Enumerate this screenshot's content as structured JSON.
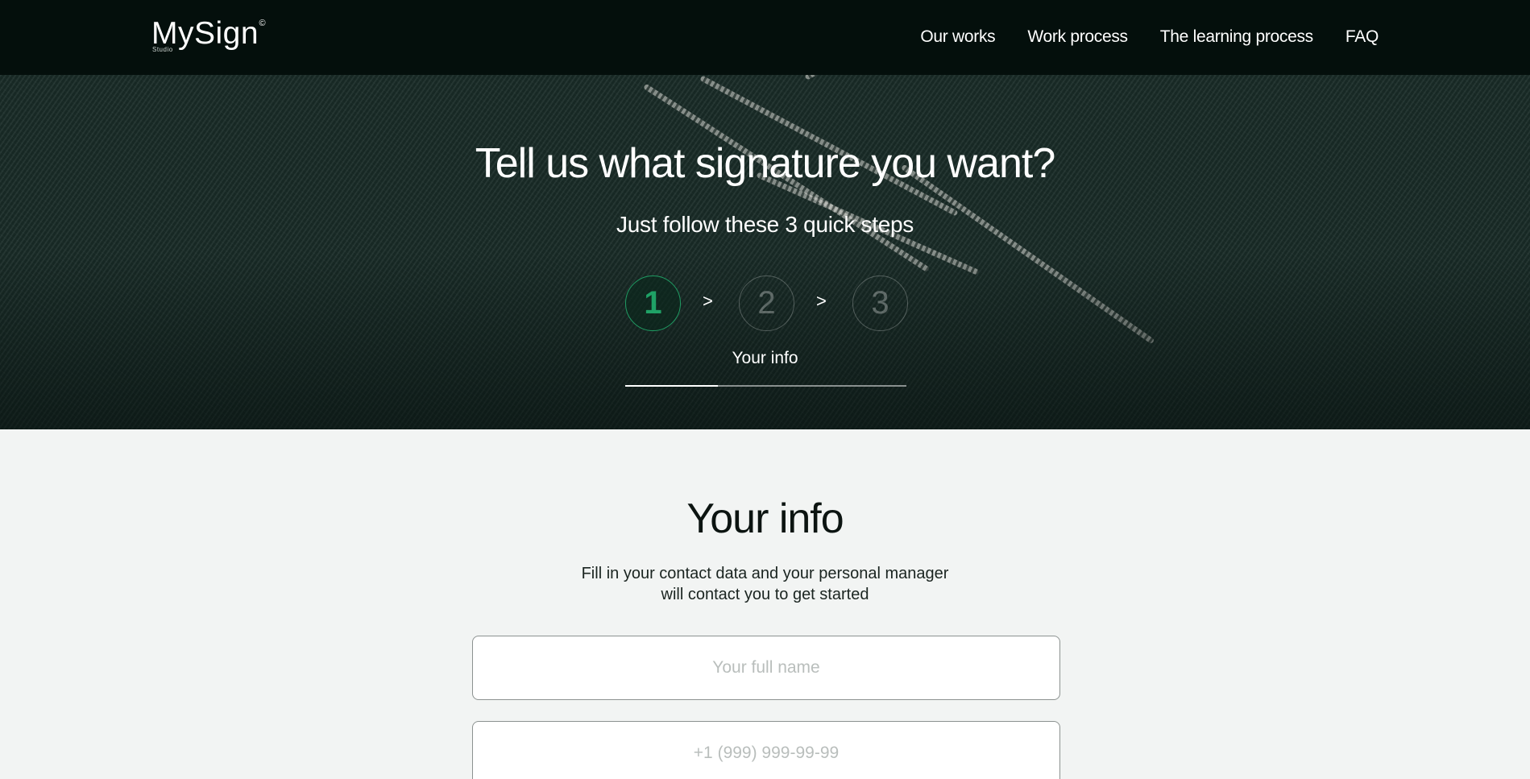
{
  "header": {
    "logo_text": "MySign",
    "logo_mark": "©",
    "logo_sub": "Studio",
    "nav": [
      {
        "label": "Our works"
      },
      {
        "label": "Work process"
      },
      {
        "label": "The learning process"
      },
      {
        "label": "FAQ"
      }
    ]
  },
  "hero": {
    "title": "Tell us what signature you want?",
    "subtitle": "Just follow these 3 quick steps",
    "steps": [
      {
        "number": "1",
        "active": true
      },
      {
        "number": "2",
        "active": false
      },
      {
        "number": "3",
        "active": false
      }
    ],
    "separator": ">",
    "current_step_label": "Your info",
    "progress": 0.33
  },
  "form": {
    "title": "Your info",
    "description_line1": "Fill in your contact data and your personal manager",
    "description_line2": "will contact you to get started",
    "name_placeholder": "Your full name",
    "phone_placeholder": "+1 (999) 999-99-99"
  },
  "colors": {
    "header_bg": "#040f0c",
    "accent_green": "#1fa166",
    "page_bg": "#f2f4f3"
  }
}
